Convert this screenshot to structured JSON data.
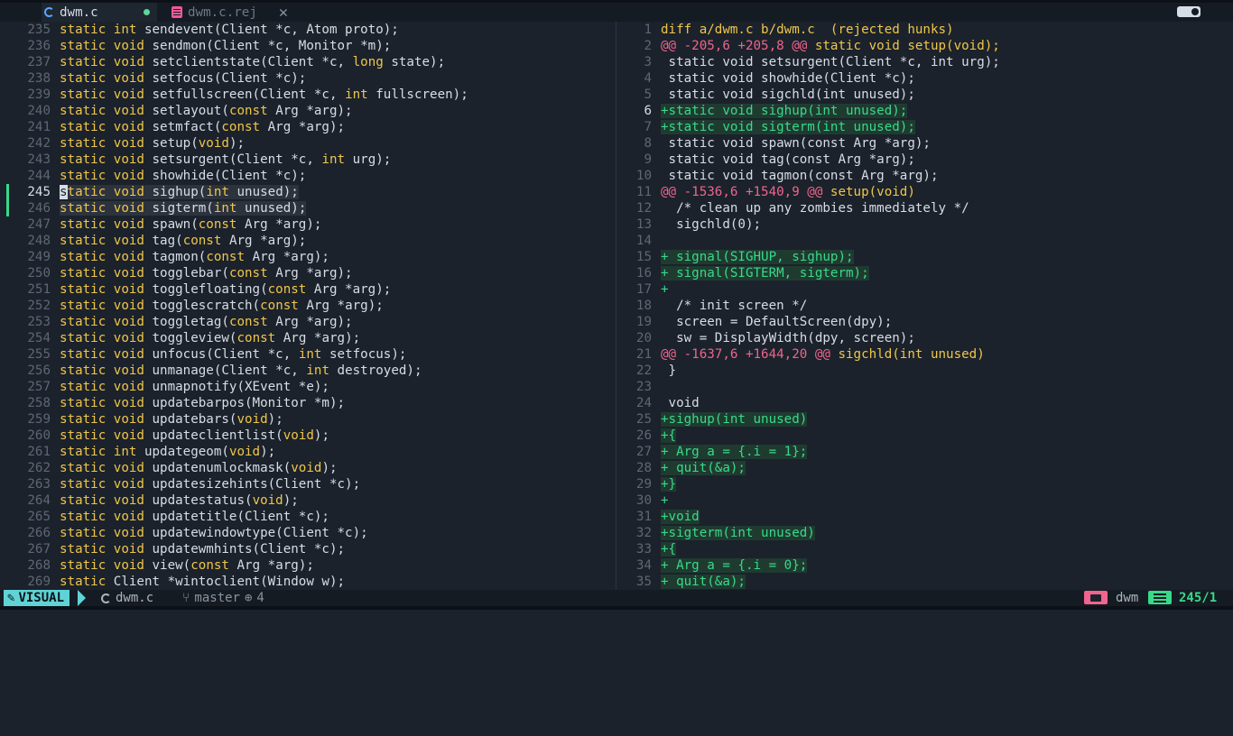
{
  "tabs": [
    {
      "label": "dwm.c",
      "modified": true
    },
    {
      "label": "dwm.c.rej"
    }
  ],
  "left": {
    "current_line": "245",
    "lines": [
      {
        "n": "235",
        "t": [
          [
            "kw",
            "static "
          ],
          [
            "kw",
            "int "
          ],
          [
            "id",
            "sendevent(Client *c, Atom proto);"
          ]
        ]
      },
      {
        "n": "236",
        "t": [
          [
            "kw",
            "static "
          ],
          [
            "kw",
            "void "
          ],
          [
            "id",
            "sendmon(Client *c, Monitor *m);"
          ]
        ]
      },
      {
        "n": "237",
        "t": [
          [
            "kw",
            "static "
          ],
          [
            "kw",
            "void "
          ],
          [
            "id",
            "setclientstate(Client *c, "
          ],
          [
            "kw",
            "long "
          ],
          [
            "id",
            "state);"
          ]
        ]
      },
      {
        "n": "238",
        "t": [
          [
            "kw",
            "static "
          ],
          [
            "kw",
            "void "
          ],
          [
            "id",
            "setfocus(Client *c);"
          ]
        ]
      },
      {
        "n": "239",
        "t": [
          [
            "kw",
            "static "
          ],
          [
            "kw",
            "void "
          ],
          [
            "id",
            "setfullscreen(Client *c, "
          ],
          [
            "kw",
            "int "
          ],
          [
            "id",
            "fullscreen);"
          ]
        ]
      },
      {
        "n": "240",
        "t": [
          [
            "kw",
            "static "
          ],
          [
            "kw",
            "void "
          ],
          [
            "id",
            "setlayout("
          ],
          [
            "kw",
            "const "
          ],
          [
            "id",
            "Arg *arg);"
          ]
        ]
      },
      {
        "n": "241",
        "t": [
          [
            "kw",
            "static "
          ],
          [
            "kw",
            "void "
          ],
          [
            "id",
            "setmfact("
          ],
          [
            "kw",
            "const "
          ],
          [
            "id",
            "Arg *arg);"
          ]
        ]
      },
      {
        "n": "242",
        "t": [
          [
            "kw",
            "static "
          ],
          [
            "kw",
            "void "
          ],
          [
            "id",
            "setup("
          ],
          [
            "kw",
            "void"
          ],
          [
            "id",
            ");"
          ]
        ]
      },
      {
        "n": "243",
        "t": [
          [
            "kw",
            "static "
          ],
          [
            "kw",
            "void "
          ],
          [
            "id",
            "setsurgent(Client *c, "
          ],
          [
            "kw",
            "int "
          ],
          [
            "id",
            "urg);"
          ]
        ]
      },
      {
        "n": "244",
        "t": [
          [
            "kw",
            "static "
          ],
          [
            "kw",
            "void "
          ],
          [
            "id",
            "showhide(Client *c);"
          ]
        ]
      },
      {
        "n": "245",
        "sel": true,
        "cursor": true,
        "t": [
          [
            "kw",
            "static "
          ],
          [
            "kw",
            "void "
          ],
          [
            "id",
            "sighup("
          ],
          [
            "kw",
            "int "
          ],
          [
            "id",
            "unused);"
          ]
        ]
      },
      {
        "n": "246",
        "sel": true,
        "t": [
          [
            "kw",
            "static "
          ],
          [
            "kw",
            "void "
          ],
          [
            "id",
            "sigterm("
          ],
          [
            "kw",
            "int "
          ],
          [
            "id",
            "unused);"
          ]
        ]
      },
      {
        "n": "247",
        "t": [
          [
            "kw",
            "static "
          ],
          [
            "kw",
            "void "
          ],
          [
            "id",
            "spawn("
          ],
          [
            "kw",
            "const "
          ],
          [
            "id",
            "Arg *arg);"
          ]
        ]
      },
      {
        "n": "248",
        "t": [
          [
            "kw",
            "static "
          ],
          [
            "kw",
            "void "
          ],
          [
            "id",
            "tag("
          ],
          [
            "kw",
            "const "
          ],
          [
            "id",
            "Arg *arg);"
          ]
        ]
      },
      {
        "n": "249",
        "t": [
          [
            "kw",
            "static "
          ],
          [
            "kw",
            "void "
          ],
          [
            "id",
            "tagmon("
          ],
          [
            "kw",
            "const "
          ],
          [
            "id",
            "Arg *arg);"
          ]
        ]
      },
      {
        "n": "250",
        "t": [
          [
            "kw",
            "static "
          ],
          [
            "kw",
            "void "
          ],
          [
            "id",
            "togglebar("
          ],
          [
            "kw",
            "const "
          ],
          [
            "id",
            "Arg *arg);"
          ]
        ]
      },
      {
        "n": "251",
        "t": [
          [
            "kw",
            "static "
          ],
          [
            "kw",
            "void "
          ],
          [
            "id",
            "togglefloating("
          ],
          [
            "kw",
            "const "
          ],
          [
            "id",
            "Arg *arg);"
          ]
        ]
      },
      {
        "n": "252",
        "t": [
          [
            "kw",
            "static "
          ],
          [
            "kw",
            "void "
          ],
          [
            "id",
            "togglescratch("
          ],
          [
            "kw",
            "const "
          ],
          [
            "id",
            "Arg *arg);"
          ]
        ]
      },
      {
        "n": "253",
        "t": [
          [
            "kw",
            "static "
          ],
          [
            "kw",
            "void "
          ],
          [
            "id",
            "toggletag("
          ],
          [
            "kw",
            "const "
          ],
          [
            "id",
            "Arg *arg);"
          ]
        ]
      },
      {
        "n": "254",
        "t": [
          [
            "kw",
            "static "
          ],
          [
            "kw",
            "void "
          ],
          [
            "id",
            "toggleview("
          ],
          [
            "kw",
            "const "
          ],
          [
            "id",
            "Arg *arg);"
          ]
        ]
      },
      {
        "n": "255",
        "t": [
          [
            "kw",
            "static "
          ],
          [
            "kw",
            "void "
          ],
          [
            "id",
            "unfocus(Client *c, "
          ],
          [
            "kw",
            "int "
          ],
          [
            "id",
            "setfocus);"
          ]
        ]
      },
      {
        "n": "256",
        "t": [
          [
            "kw",
            "static "
          ],
          [
            "kw",
            "void "
          ],
          [
            "id",
            "unmanage(Client *c, "
          ],
          [
            "kw",
            "int "
          ],
          [
            "id",
            "destroyed);"
          ]
        ]
      },
      {
        "n": "257",
        "t": [
          [
            "kw",
            "static "
          ],
          [
            "kw",
            "void "
          ],
          [
            "id",
            "unmapnotify(XEvent *e);"
          ]
        ]
      },
      {
        "n": "258",
        "t": [
          [
            "kw",
            "static "
          ],
          [
            "kw",
            "void "
          ],
          [
            "id",
            "updatebarpos(Monitor *m);"
          ]
        ]
      },
      {
        "n": "259",
        "t": [
          [
            "kw",
            "static "
          ],
          [
            "kw",
            "void "
          ],
          [
            "id",
            "updatebars("
          ],
          [
            "kw",
            "void"
          ],
          [
            "id",
            ");"
          ]
        ]
      },
      {
        "n": "260",
        "t": [
          [
            "kw",
            "static "
          ],
          [
            "kw",
            "void "
          ],
          [
            "id",
            "updateclientlist("
          ],
          [
            "kw",
            "void"
          ],
          [
            "id",
            ");"
          ]
        ]
      },
      {
        "n": "261",
        "t": [
          [
            "kw",
            "static "
          ],
          [
            "kw",
            "int "
          ],
          [
            "id",
            "updategeom("
          ],
          [
            "kw",
            "void"
          ],
          [
            "id",
            ");"
          ]
        ]
      },
      {
        "n": "262",
        "t": [
          [
            "kw",
            "static "
          ],
          [
            "kw",
            "void "
          ],
          [
            "id",
            "updatenumlockmask("
          ],
          [
            "kw",
            "void"
          ],
          [
            "id",
            ");"
          ]
        ]
      },
      {
        "n": "263",
        "t": [
          [
            "kw",
            "static "
          ],
          [
            "kw",
            "void "
          ],
          [
            "id",
            "updatesizehints(Client *c);"
          ]
        ]
      },
      {
        "n": "264",
        "t": [
          [
            "kw",
            "static "
          ],
          [
            "kw",
            "void "
          ],
          [
            "id",
            "updatestatus("
          ],
          [
            "kw",
            "void"
          ],
          [
            "id",
            ");"
          ]
        ]
      },
      {
        "n": "265",
        "t": [
          [
            "kw",
            "static "
          ],
          [
            "kw",
            "void "
          ],
          [
            "id",
            "updatetitle(Client *c);"
          ]
        ]
      },
      {
        "n": "266",
        "t": [
          [
            "kw",
            "static "
          ],
          [
            "kw",
            "void "
          ],
          [
            "id",
            "updatewindowtype(Client *c);"
          ]
        ]
      },
      {
        "n": "267",
        "t": [
          [
            "kw",
            "static "
          ],
          [
            "kw",
            "void "
          ],
          [
            "id",
            "updatewmhints(Client *c);"
          ]
        ]
      },
      {
        "n": "268",
        "t": [
          [
            "kw",
            "static "
          ],
          [
            "kw",
            "void "
          ],
          [
            "id",
            "view("
          ],
          [
            "kw",
            "const "
          ],
          [
            "id",
            "Arg *arg);"
          ]
        ]
      },
      {
        "n": "269",
        "t": [
          [
            "kw",
            "static "
          ],
          [
            "id",
            "Client *wintoclient(Window w);"
          ]
        ]
      }
    ]
  },
  "right": {
    "current_line": "6",
    "lines": [
      {
        "n": "1",
        "k": "hdr",
        "s": "diff a/dwm.c b/dwm.c  (rejected hunks)"
      },
      {
        "n": "2",
        "k": "hunk",
        "s": "@@ -205,6 +205,8 @@",
        "tail": " static void setup(void);"
      },
      {
        "n": "3",
        "k": "plain",
        "s": " static void setsurgent(Client *c, int urg);"
      },
      {
        "n": "4",
        "k": "plain",
        "s": " static void showhide(Client *c);"
      },
      {
        "n": "5",
        "k": "plain",
        "s": " static void sigchld(int unused);"
      },
      {
        "n": "6",
        "k": "add",
        "s": "+static void sighup(int unused);"
      },
      {
        "n": "7",
        "k": "add",
        "s": "+static void sigterm(int unused);"
      },
      {
        "n": "8",
        "k": "plain",
        "s": " static void spawn(const Arg *arg);"
      },
      {
        "n": "9",
        "k": "plain",
        "s": " static void tag(const Arg *arg);"
      },
      {
        "n": "10",
        "k": "plain",
        "s": " static void tagmon(const Arg *arg);"
      },
      {
        "n": "11",
        "k": "hunk",
        "s": "@@ -1536,6 +1540,9 @@",
        "tail": " setup(void)"
      },
      {
        "n": "12",
        "k": "plain",
        "s": "  /* clean up any zombies immediately */"
      },
      {
        "n": "13",
        "k": "plain",
        "s": "  sigchld(0);"
      },
      {
        "n": "14",
        "k": "plain",
        "s": ""
      },
      {
        "n": "15",
        "k": "add",
        "s": "+ signal(SIGHUP, sighup);"
      },
      {
        "n": "16",
        "k": "add",
        "s": "+ signal(SIGTERM, sigterm);"
      },
      {
        "n": "17",
        "k": "add",
        "s": "+"
      },
      {
        "n": "18",
        "k": "plain",
        "s": "  /* init screen */"
      },
      {
        "n": "19",
        "k": "plain",
        "s": "  screen = DefaultScreen(dpy);"
      },
      {
        "n": "20",
        "k": "plain",
        "s": "  sw = DisplayWidth(dpy, screen);"
      },
      {
        "n": "21",
        "k": "hunk",
        "s": "@@ -1637,6 +1644,20 @@",
        "tail": " sigchld(int unused)"
      },
      {
        "n": "22",
        "k": "plain",
        "s": " }"
      },
      {
        "n": "23",
        "k": "plain",
        "s": ""
      },
      {
        "n": "24",
        "k": "plain",
        "s": " void"
      },
      {
        "n": "25",
        "k": "add",
        "s": "+sighup(int unused)"
      },
      {
        "n": "26",
        "k": "add",
        "s": "+{"
      },
      {
        "n": "27",
        "k": "add",
        "s": "+ Arg a = {.i = 1};"
      },
      {
        "n": "28",
        "k": "add",
        "s": "+ quit(&a);"
      },
      {
        "n": "29",
        "k": "add",
        "s": "+}"
      },
      {
        "n": "30",
        "k": "add",
        "s": "+"
      },
      {
        "n": "31",
        "k": "add",
        "s": "+void"
      },
      {
        "n": "32",
        "k": "add",
        "s": "+sigterm(int unused)"
      },
      {
        "n": "33",
        "k": "add",
        "s": "+{"
      },
      {
        "n": "34",
        "k": "add",
        "s": "+ Arg a = {.i = 0};"
      },
      {
        "n": "35",
        "k": "add",
        "s": "+ quit(&a);"
      }
    ]
  },
  "status": {
    "mode": "VISUAL",
    "file": "dwm.c",
    "branch": "master",
    "changes": "4",
    "project": "dwm",
    "position": "245/1"
  },
  "colors": {
    "keyword": "#f0c64a",
    "added": "#39d98a",
    "hunk": "#f0648e",
    "mode_bg": "#5fd3d6"
  }
}
